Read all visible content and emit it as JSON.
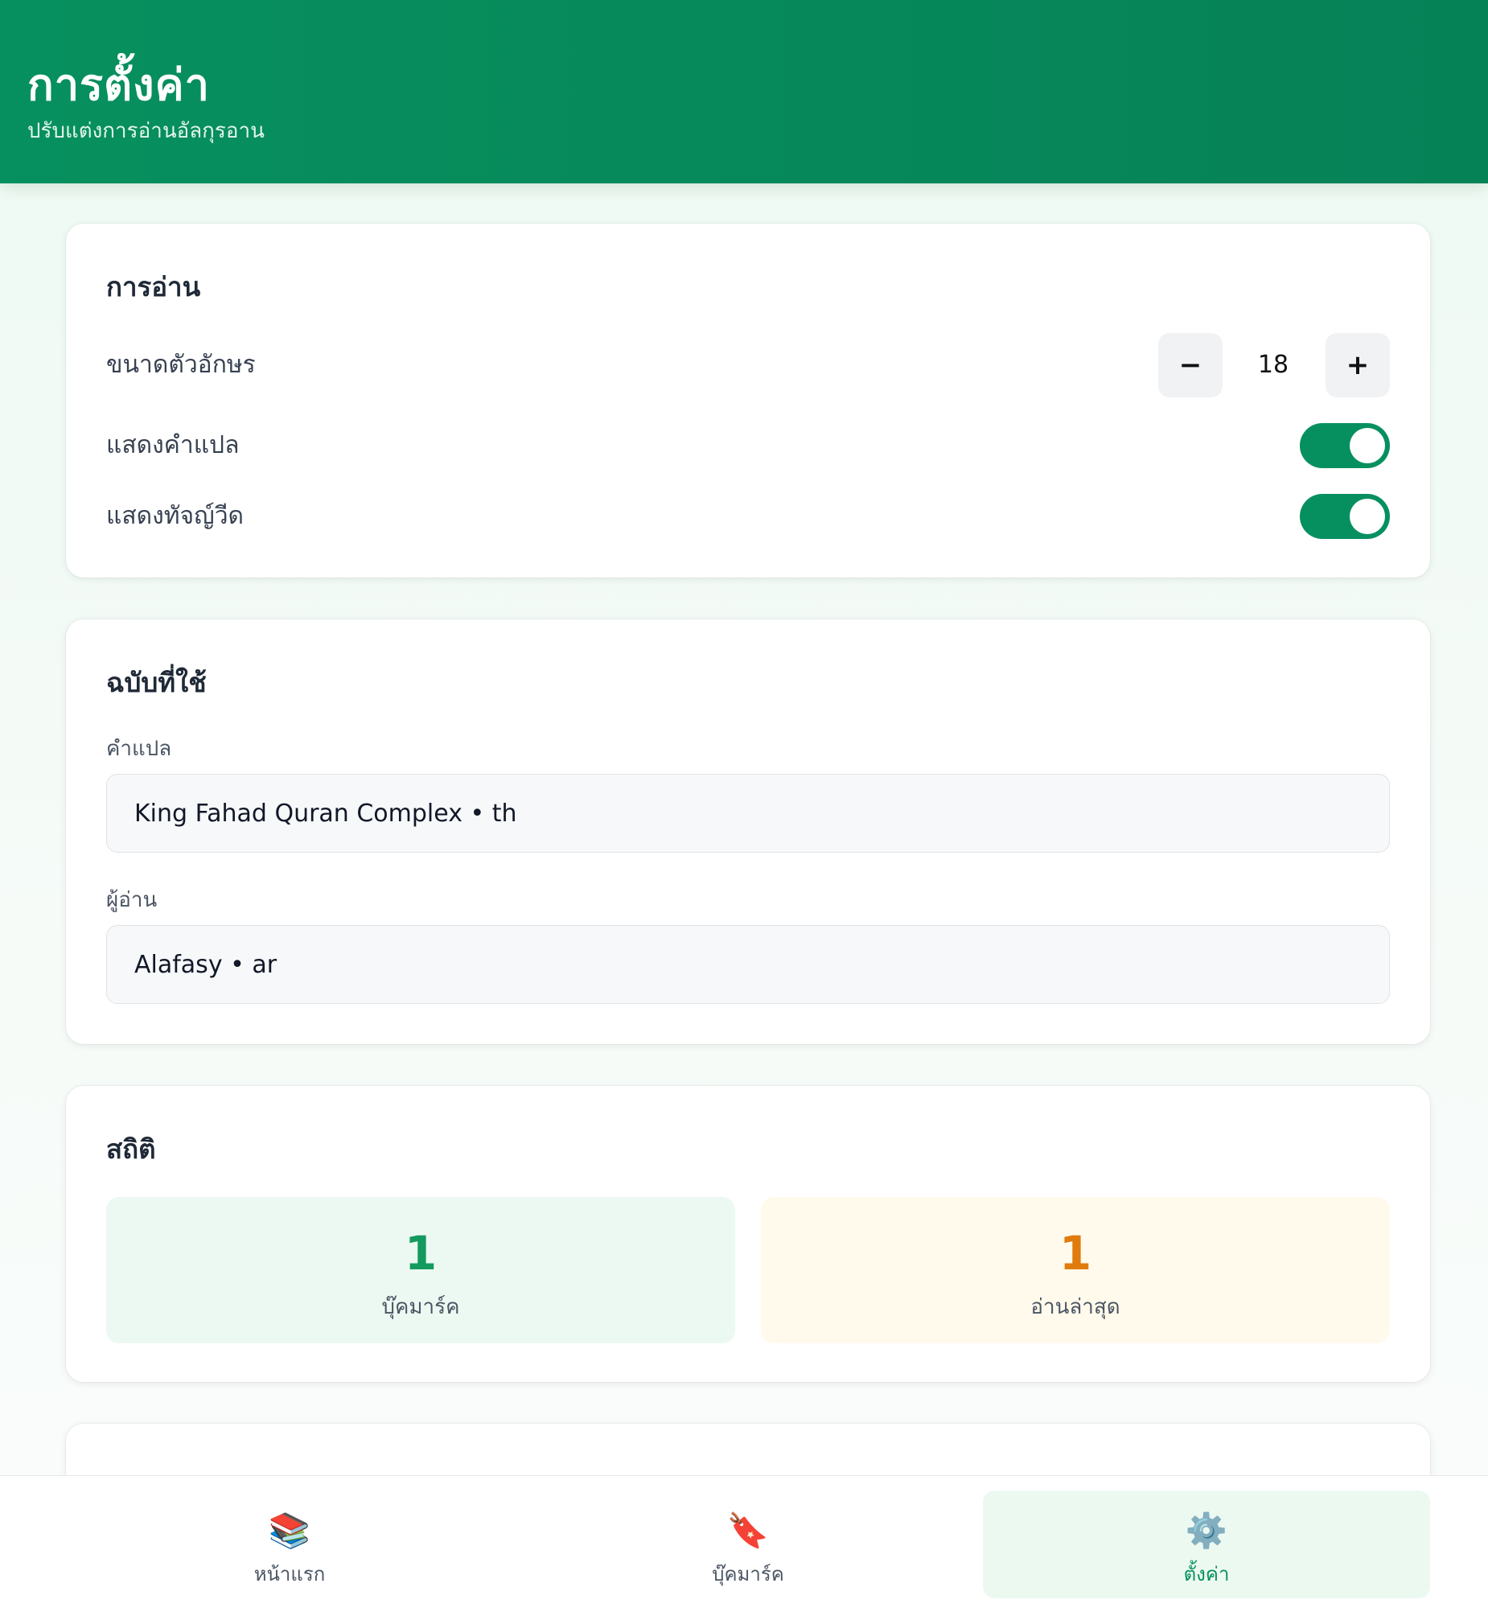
{
  "header": {
    "title": "การตั้งค่า",
    "subtitle": "ปรับแต่งการอ่านอัลกุรอาน"
  },
  "reading": {
    "title": "การอ่าน",
    "font_size_label": "ขนาดตัวอักษร",
    "font_size_value": "18",
    "decrement_label": "−",
    "increment_label": "+",
    "show_translation_label": "แสดงคำแปล",
    "show_translation_on": true,
    "show_tajweed_label": "แสดงทัจญ์วีด",
    "show_tajweed_on": true
  },
  "edition": {
    "title": "ฉบับที่ใช้",
    "translation_label": "คำแปล",
    "translation_value": "King Fahad Quran Complex • th",
    "reciter_label": "ผู้อ่าน",
    "reciter_value": "Alafasy • ar"
  },
  "stats": {
    "title": "สถิติ",
    "bookmarks_count": "1",
    "bookmarks_label": "บุ๊คมาร์ค",
    "bookmarks_color": "#149a5e",
    "bookmarks_bg": "#ecf9f2",
    "recent_count": "1",
    "recent_label": "อ่านล่าสุด",
    "recent_color": "#e07b0e",
    "recent_bg": "#fffaeb"
  },
  "bottom_nav": {
    "items": [
      {
        "label": "หน้าแรก",
        "icon": "books-icon",
        "glyph": "📚",
        "active": false
      },
      {
        "label": "บุ๊คมาร์ค",
        "icon": "bookmark-icon",
        "glyph": "🔖",
        "active": false
      },
      {
        "label": "ตั้งค่า",
        "icon": "gear-icon",
        "glyph": "⚙️",
        "active": true
      }
    ]
  },
  "colors": {
    "accent": "#07905f",
    "header_bg": "#07905f"
  }
}
